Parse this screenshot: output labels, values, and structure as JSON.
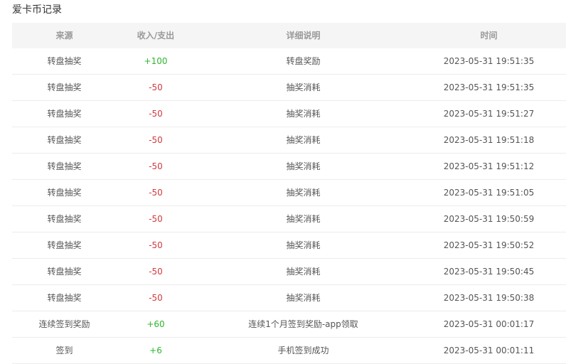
{
  "title": "爱卡币记录",
  "colors": {
    "positive": "#2fb62f",
    "negative": "#d0393e",
    "header_bg": "#f5f5f5"
  },
  "headers": [
    "来源",
    "收入/支出",
    "详细说明",
    "时间"
  ],
  "rows": [
    {
      "source": "转盘抽奖",
      "amount": "+100",
      "detail": "转盘奖励",
      "time": "2023-05-31 19:51:35",
      "sign": "pos"
    },
    {
      "source": "转盘抽奖",
      "amount": "-50",
      "detail": "抽奖消耗",
      "time": "2023-05-31 19:51:35",
      "sign": "neg"
    },
    {
      "source": "转盘抽奖",
      "amount": "-50",
      "detail": "抽奖消耗",
      "time": "2023-05-31 19:51:27",
      "sign": "neg"
    },
    {
      "source": "转盘抽奖",
      "amount": "-50",
      "detail": "抽奖消耗",
      "time": "2023-05-31 19:51:18",
      "sign": "neg"
    },
    {
      "source": "转盘抽奖",
      "amount": "-50",
      "detail": "抽奖消耗",
      "time": "2023-05-31 19:51:12",
      "sign": "neg"
    },
    {
      "source": "转盘抽奖",
      "amount": "-50",
      "detail": "抽奖消耗",
      "time": "2023-05-31 19:51:05",
      "sign": "neg"
    },
    {
      "source": "转盘抽奖",
      "amount": "-50",
      "detail": "抽奖消耗",
      "time": "2023-05-31 19:50:59",
      "sign": "neg"
    },
    {
      "source": "转盘抽奖",
      "amount": "-50",
      "detail": "抽奖消耗",
      "time": "2023-05-31 19:50:52",
      "sign": "neg"
    },
    {
      "source": "转盘抽奖",
      "amount": "-50",
      "detail": "抽奖消耗",
      "time": "2023-05-31 19:50:45",
      "sign": "neg"
    },
    {
      "source": "转盘抽奖",
      "amount": "-50",
      "detail": "抽奖消耗",
      "time": "2023-05-31 19:50:38",
      "sign": "neg"
    },
    {
      "source": "连续签到奖励",
      "amount": "+60",
      "detail": "连续1个月签到奖励-app领取",
      "time": "2023-05-31 00:01:17",
      "sign": "pos"
    },
    {
      "source": "签到",
      "amount": "+6",
      "detail": "手机签到成功",
      "time": "2023-05-31 00:01:11",
      "sign": "pos"
    }
  ]
}
